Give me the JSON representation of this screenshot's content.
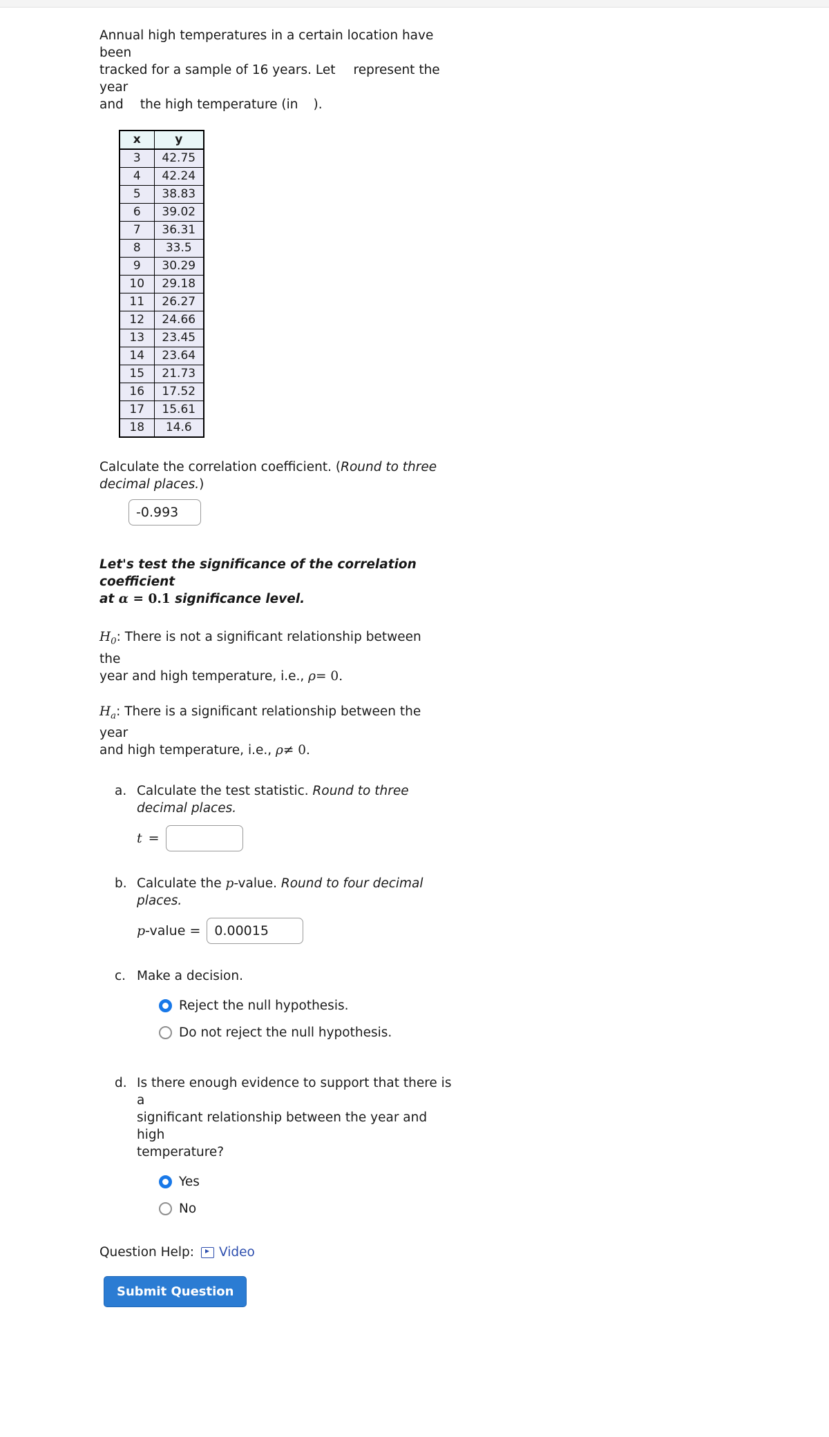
{
  "intro": {
    "line1": "Annual high temperatures in a certain location have been",
    "line2a": "tracked for a sample of 16 years. Let",
    "line2b": "represent the year",
    "line3a": "and",
    "line3b": "the high temperature (in",
    "line3c": ")."
  },
  "table": {
    "headers": [
      "x",
      "y"
    ],
    "rows": [
      [
        "3",
        "42.75"
      ],
      [
        "4",
        "42.24"
      ],
      [
        "5",
        "38.83"
      ],
      [
        "6",
        "39.02"
      ],
      [
        "7",
        "36.31"
      ],
      [
        "8",
        "33.5"
      ],
      [
        "9",
        "30.29"
      ],
      [
        "10",
        "29.18"
      ],
      [
        "11",
        "26.27"
      ],
      [
        "12",
        "24.66"
      ],
      [
        "13",
        "23.45"
      ],
      [
        "14",
        "23.64"
      ],
      [
        "15",
        "21.73"
      ],
      [
        "16",
        "17.52"
      ],
      [
        "17",
        "15.61"
      ],
      [
        "18",
        "14.6"
      ]
    ]
  },
  "correlation": {
    "prompt_plain": "Calculate the correlation coefficient. (",
    "prompt_italic": "Round to three decimal places.",
    "prompt_close": ")",
    "value": "-0.993"
  },
  "significance": {
    "lead": "Let's test the significance of the correlation coefficient",
    "at": "at",
    "alpha": "α",
    "equals": "=",
    "alpha_value": "0.1",
    "tail": "significance level."
  },
  "hypotheses": {
    "null": {
      "symbol": "H",
      "sub": "0",
      "text_line1": ": There is not a significant relationship between the",
      "text_line2": "year and high temperature, i.e.,",
      "rho": "ρ",
      "relation": "= 0."
    },
    "alt": {
      "symbol": "H",
      "sub": "a",
      "text_line1": ": There is a significant relationship between the year",
      "text_line2": "and high temperature, i.e.,",
      "rho": "ρ",
      "relation": "≠ 0."
    }
  },
  "parts": {
    "a": {
      "marker": "a.",
      "prompt_plain": "Calculate the test statistic. ",
      "prompt_italic": "Round to three decimal places.",
      "label_t": "t",
      "label_eq": "=",
      "value": "",
      "placeholder": ""
    },
    "b": {
      "marker": "b.",
      "prompt_plain_1": "Calculate the ",
      "prompt_p": "p",
      "prompt_plain_2": "-value. ",
      "prompt_italic": "Round to four decimal places.",
      "label_p": "p",
      "label_rest": "-value =",
      "value": "0.00015"
    },
    "c": {
      "marker": "c.",
      "prompt": "Make a decision.",
      "options": [
        {
          "label": "Reject the null hypothesis.",
          "selected": true
        },
        {
          "label": "Do not reject the null hypothesis.",
          "selected": false
        }
      ]
    },
    "d": {
      "marker": "d.",
      "prompt_line1": "Is there enough evidence to support that there is a",
      "prompt_line2": "significant relationship between the year and high",
      "prompt_line3": "temperature?",
      "options": [
        {
          "label": "Yes",
          "selected": true
        },
        {
          "label": "No",
          "selected": false
        }
      ]
    }
  },
  "footer": {
    "help_label": "Question Help:",
    "video_label": "Video",
    "submit_label": "Submit Question"
  },
  "colors": {
    "accent": "#1878e8",
    "submit_bg": "#2b7cd3",
    "link": "#2d4eae",
    "header_cell": "#e9f6f7",
    "data_cell": "#ebebf7"
  }
}
